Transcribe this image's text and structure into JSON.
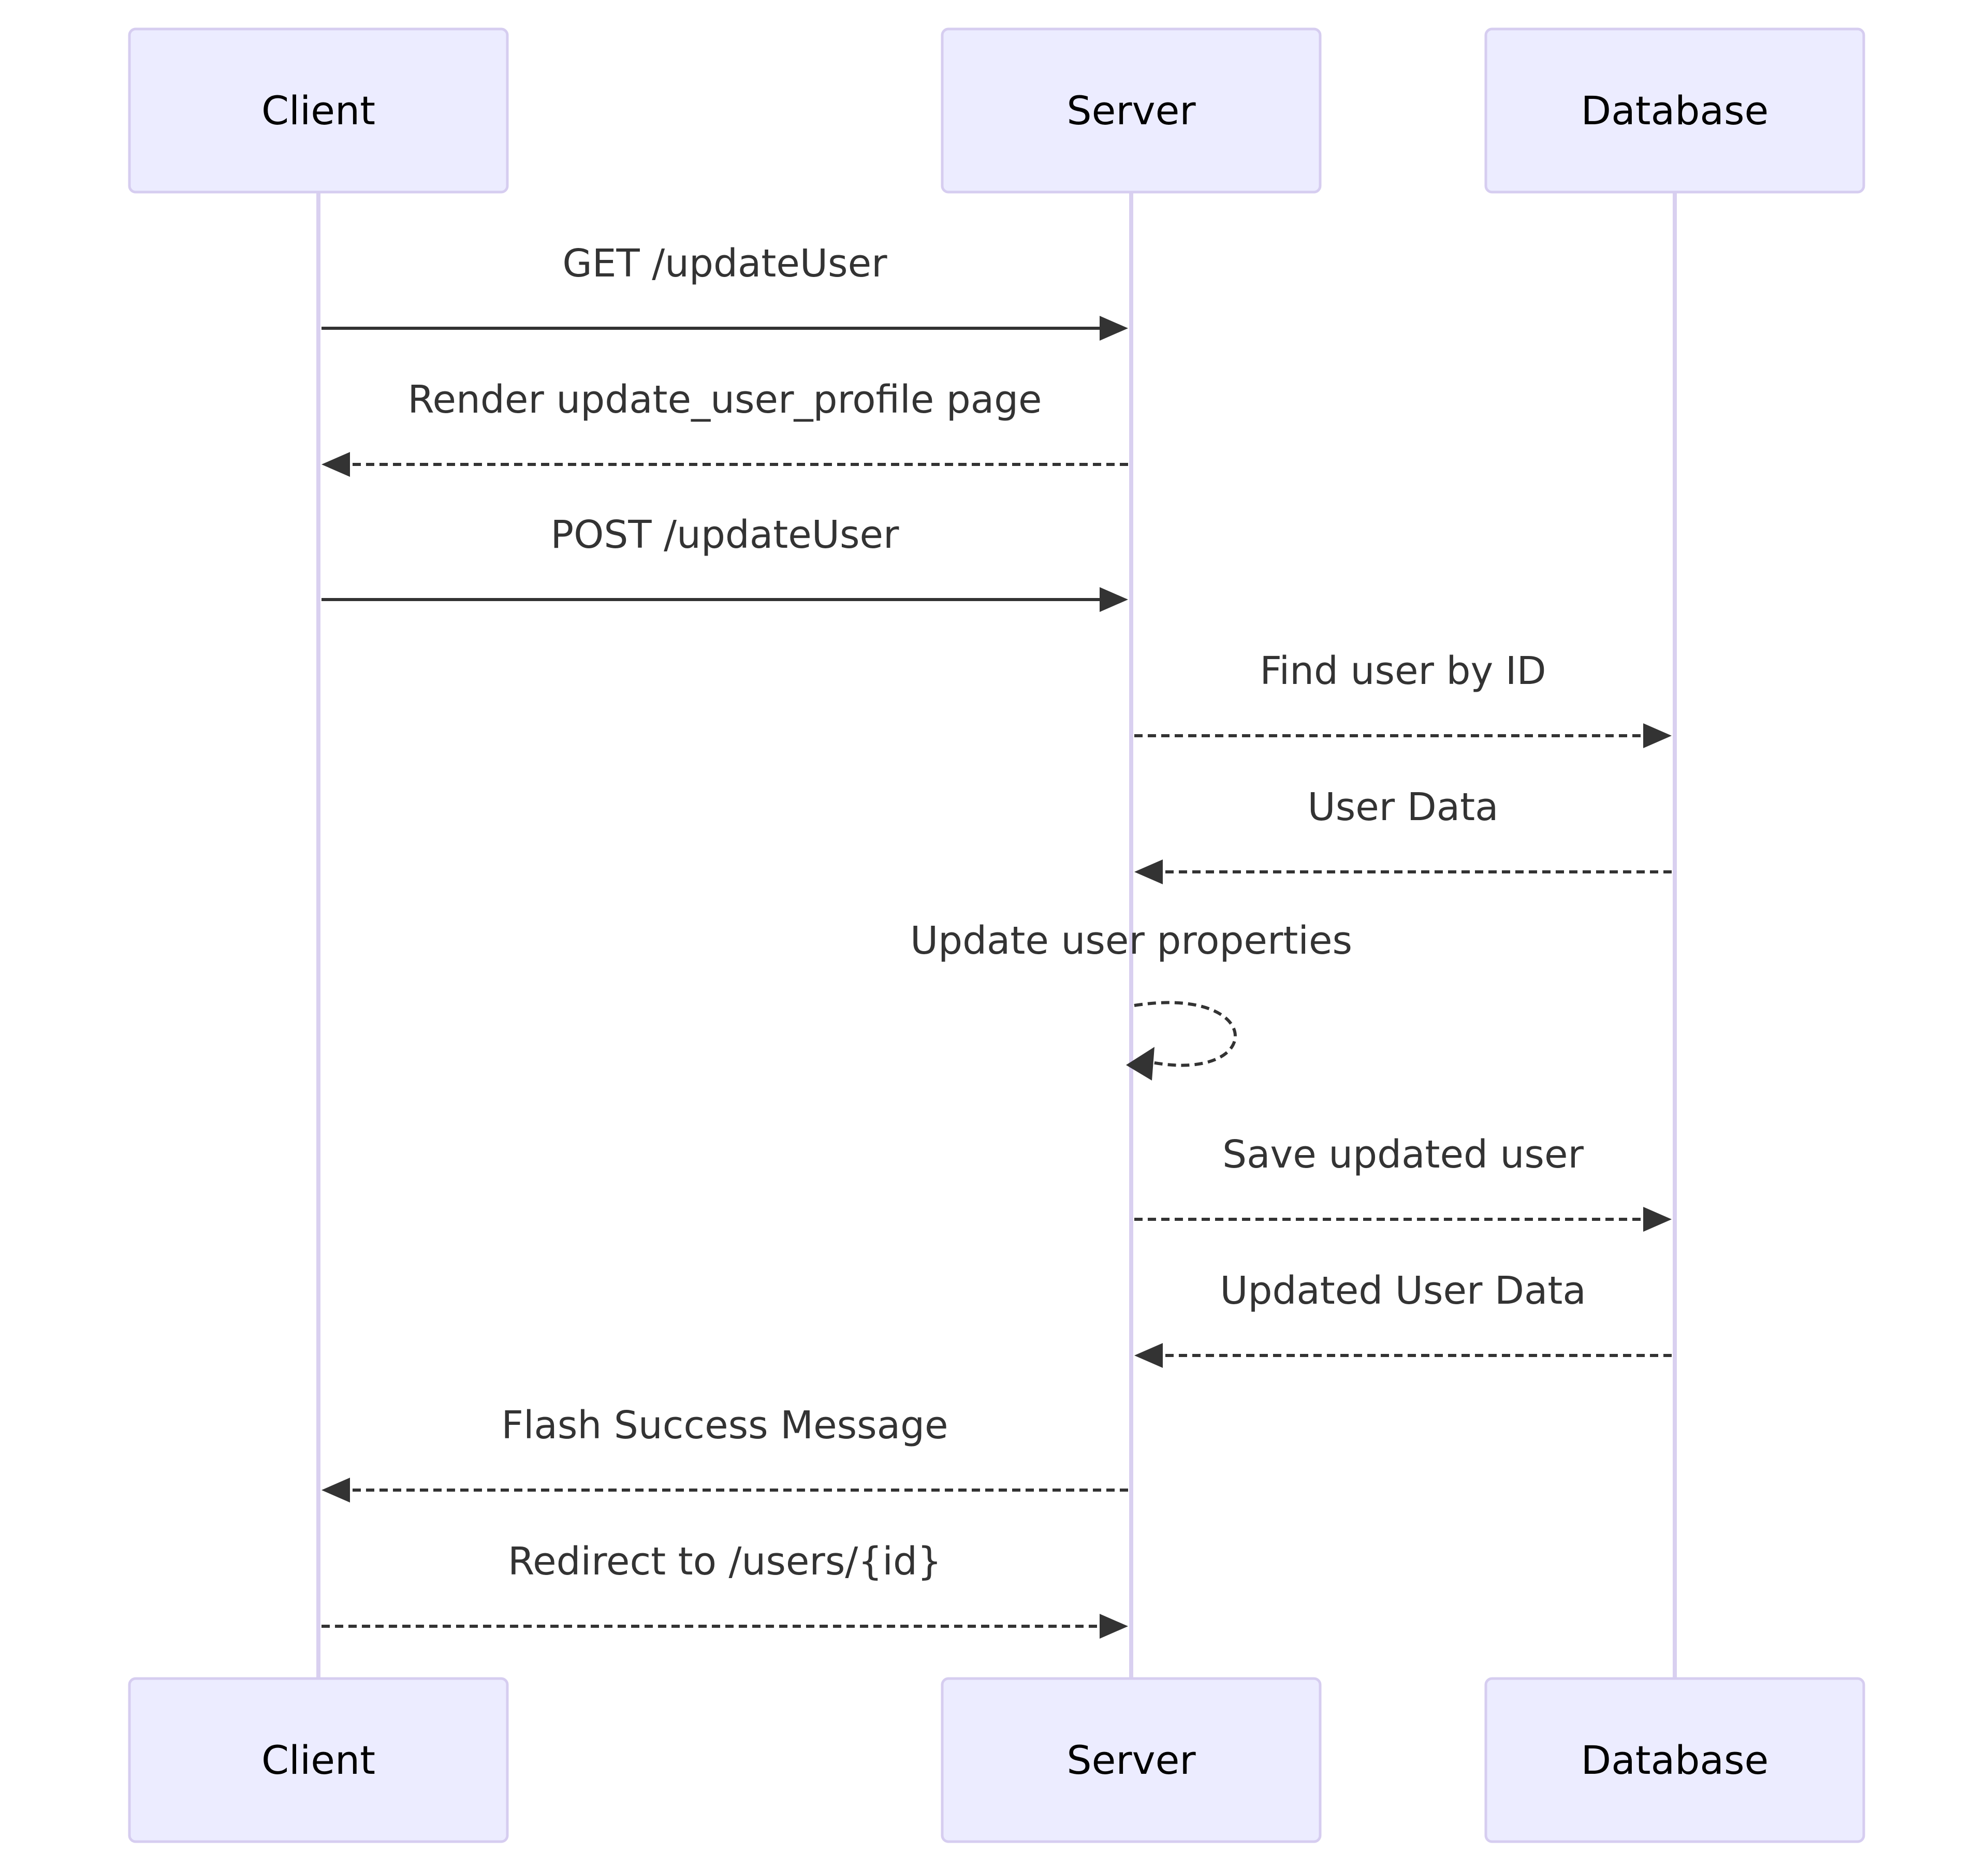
{
  "diagram": {
    "type": "sequence",
    "colors": {
      "actor_fill": "#ececff",
      "actor_border": "#d6cdf0",
      "lifeline": "#d9d0f0",
      "message": "#333333"
    },
    "actors": [
      {
        "id": "client",
        "label": "Client"
      },
      {
        "id": "server",
        "label": "Server"
      },
      {
        "id": "database",
        "label": "Database"
      }
    ],
    "messages": [
      {
        "from": "client",
        "to": "server",
        "label": "GET /updateUser",
        "style": "solid"
      },
      {
        "from": "server",
        "to": "client",
        "label": "Render update_user_profile page",
        "style": "dotted"
      },
      {
        "from": "client",
        "to": "server",
        "label": "POST /updateUser",
        "style": "solid"
      },
      {
        "from": "server",
        "to": "database",
        "label": "Find user by ID",
        "style": "dotted"
      },
      {
        "from": "database",
        "to": "server",
        "label": "User Data",
        "style": "dotted"
      },
      {
        "from": "server",
        "to": "server",
        "label": "Update user properties",
        "style": "dotted"
      },
      {
        "from": "server",
        "to": "database",
        "label": "Save updated user",
        "style": "dotted"
      },
      {
        "from": "database",
        "to": "server",
        "label": "Updated User Data",
        "style": "dotted"
      },
      {
        "from": "server",
        "to": "client",
        "label": "Flash Success Message",
        "style": "dotted"
      },
      {
        "from": "client",
        "to": "server",
        "label": "Redirect to /users/{id}",
        "style": "dotted"
      }
    ]
  }
}
